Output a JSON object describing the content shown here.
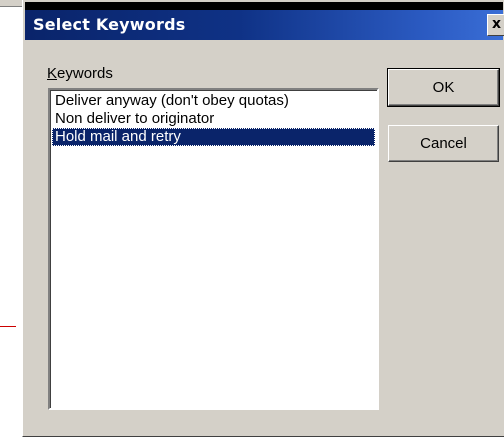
{
  "dialog": {
    "title": "Select Keywords",
    "close_label": "x"
  },
  "keywords": {
    "label_accel": "K",
    "label_rest": "eywords",
    "items": [
      {
        "label": "Deliver anyway (don't obey quotas)",
        "selected": false
      },
      {
        "label": "Non deliver to originator",
        "selected": false
      },
      {
        "label": "Hold mail and retry",
        "selected": true
      }
    ]
  },
  "buttons": {
    "ok_label": "OK",
    "cancel_label": "Cancel"
  },
  "colors": {
    "title_bar": "#0a246a",
    "selection": "#0a246a",
    "face": "#d4d0c8"
  }
}
